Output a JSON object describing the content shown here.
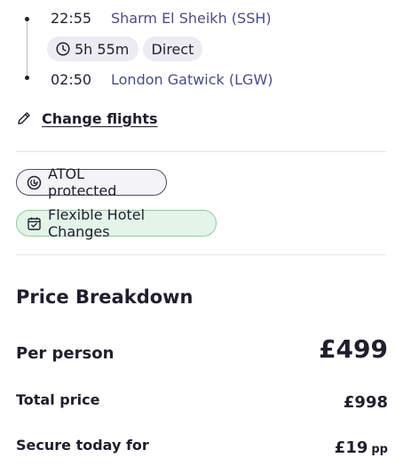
{
  "flight": {
    "departure_time": "22:55",
    "departure_airport": "Sharm El Sheikh (SSH)",
    "duration": "5h 55m",
    "stops": "Direct",
    "arrival_time": "02:50",
    "arrival_airport": "London Gatwick (LGW)"
  },
  "change_flights": {
    "label": "Change flights",
    "icon": "pencil-icon"
  },
  "badges": {
    "atol": {
      "label": "ATOL protected",
      "icon": "atol-shield-icon"
    },
    "flexible": {
      "label": "Flexible Hotel Changes",
      "icon": "calendar-check-icon",
      "color": "#e3f4e8"
    }
  },
  "price_breakdown": {
    "title": "Price Breakdown",
    "per_person_label": "Per person",
    "per_person_value": "£499",
    "total_label": "Total price",
    "total_value": "£998",
    "secure_label": "Secure today for",
    "secure_value": "£19",
    "secure_suffix": "pp"
  }
}
